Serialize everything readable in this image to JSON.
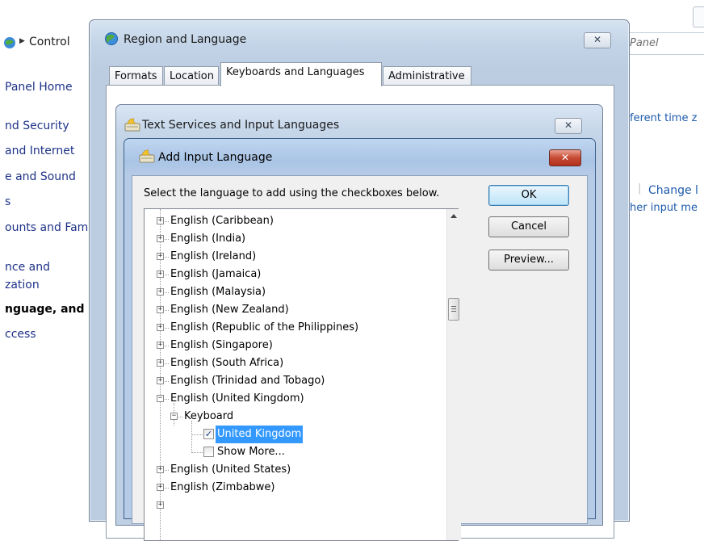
{
  "control_panel": {
    "breadcrumb_label": "Control",
    "search_placeholder": "Panel",
    "sidebar_items": [
      "Panel Home",
      "nd Security",
      "and Internet",
      "e and Sound",
      "s",
      "ounts and Fam",
      "nce and",
      "zation",
      "nguage, and R",
      "ccess"
    ],
    "right_text_1": "ferent time z",
    "right_link_change": "Change l",
    "right_text_2": "her input me"
  },
  "region_window": {
    "title": "Region and Language",
    "close_glyph": "✕",
    "tabs": [
      "Formats",
      "Location",
      "Keyboards and Languages",
      "Administrative"
    ],
    "active_tab": "Keyboards and Languages"
  },
  "text_services_window": {
    "title": "Text Services and Input Languages",
    "close_glyph": "✕"
  },
  "add_language_dialog": {
    "title": "Add Input Language",
    "close_glyph": "✕",
    "instruction": "Select the language to add using the checkboxes below.",
    "buttons": {
      "ok": "OK",
      "cancel": "Cancel",
      "preview": "Preview..."
    },
    "tree": {
      "languages_before": [
        "English (Caribbean)",
        "English (India)",
        "English (Ireland)",
        "English (Jamaica)",
        "English (Malaysia)",
        "English (New Zealand)",
        "English (Republic of the Philippines)",
        "English (Singapore)",
        "English (South Africa)",
        "English (Trinidad and Tobago)"
      ],
      "expanded_language": "English (United Kingdom)",
      "keyboard_node": "Keyboard",
      "keyboard_items": [
        {
          "label": "United Kingdom",
          "checked": true,
          "selected": true
        },
        {
          "label": "Show More...",
          "checked": false,
          "selected": false
        }
      ],
      "languages_after": [
        "English (United States)",
        "English (Zimbabwe)"
      ]
    }
  },
  "colors": {
    "selection": "#3399ff",
    "link": "#1e5bab",
    "close_red": "#c74a33"
  }
}
